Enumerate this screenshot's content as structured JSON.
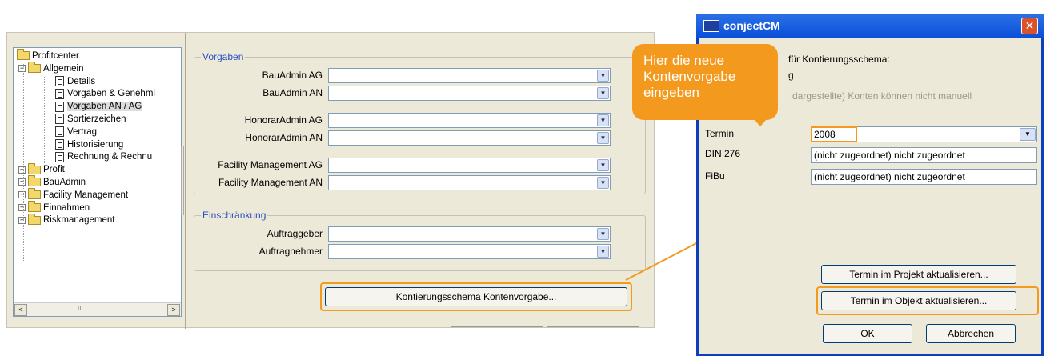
{
  "tree": {
    "items": [
      {
        "label": "Profitcenter",
        "level": 0,
        "icon": "folder-open-icon",
        "expander": ""
      },
      {
        "label": "Allgemein",
        "level": 1,
        "icon": "folder-open-icon",
        "expander": "−"
      },
      {
        "label": "Details",
        "level": 2,
        "icon": "document-icon"
      },
      {
        "label": "Vorgaben & Genehmi",
        "level": 2,
        "icon": "document-icon"
      },
      {
        "label": "Vorgaben AN / AG",
        "level": 2,
        "icon": "document-icon",
        "selected": true
      },
      {
        "label": "Sortierzeichen",
        "level": 2,
        "icon": "document-icon"
      },
      {
        "label": "Vertrag",
        "level": 2,
        "icon": "document-icon"
      },
      {
        "label": "Historisierung",
        "level": 2,
        "icon": "document-icon"
      },
      {
        "label": "Rechnung & Rechnu",
        "level": 2,
        "icon": "document-icon"
      },
      {
        "label": "Profit",
        "level": 1,
        "icon": "folder-icon",
        "expander": "+"
      },
      {
        "label": "BauAdmin",
        "level": 1,
        "icon": "folder-icon",
        "expander": "+"
      },
      {
        "label": "Facility Management",
        "level": 1,
        "icon": "folder-icon",
        "expander": "+"
      },
      {
        "label": "Einnahmen",
        "level": 1,
        "icon": "folder-icon",
        "expander": "+"
      },
      {
        "label": "Riskmanagement",
        "level": 1,
        "icon": "folder-icon",
        "expander": "+"
      }
    ],
    "scroll_left": "<",
    "scroll_right": ">",
    "scroll_grip": "III"
  },
  "vorgaben": {
    "legend": "Vorgaben",
    "fields": [
      {
        "label": "BauAdmin AG",
        "value": ""
      },
      {
        "label": "BauAdmin AN",
        "value": ""
      },
      {
        "label": "HonorarAdmin AG",
        "value": ""
      },
      {
        "label": "HonorarAdmin AN",
        "value": ""
      },
      {
        "label": "Facility Management AG",
        "value": ""
      },
      {
        "label": "Facility Management AN",
        "value": ""
      }
    ]
  },
  "einschraenkung": {
    "legend": "Einschränkung",
    "fields": [
      {
        "label": "Auftraggeber",
        "value": ""
      },
      {
        "label": "Auftragnehmer",
        "value": ""
      }
    ]
  },
  "kontenvorgabe_button": "Kontierungsschema Kontenvorgabe...",
  "callout": {
    "text": "Hier die neue Kontenvorgabe eingeben"
  },
  "dialog": {
    "title": "conjectCM",
    "close_glyph": "✕",
    "intro_line1": "für Kontierungsschema:",
    "intro_line2": "g",
    "intro_line3": "dargestellte) Konten können nicht manuell",
    "termin_label": "Termin",
    "termin_value": "2008",
    "din_label": "DIN 276",
    "din_value": "(nicht zugeordnet)   nicht zugeordnet",
    "fibu_label": "FiBu",
    "fibu_value": "(nicht zugeordnet)   nicht zugeordnet",
    "btn_projekt": "Termin im Projekt aktualisieren...",
    "btn_objekt": "Termin im Objekt aktualisieren...",
    "btn_ok": "OK",
    "btn_cancel": "Abbrechen"
  },
  "colors": {
    "highlight": "#f39a1e",
    "legend_blue": "#2c4fc6",
    "title_blue": "#0a4fd8"
  }
}
